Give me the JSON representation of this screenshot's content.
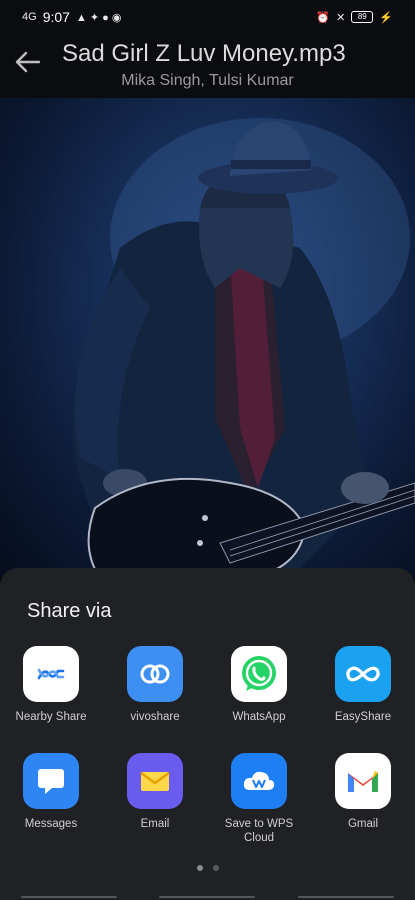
{
  "status_bar": {
    "signal": "4G",
    "time": "9:07",
    "battery": "89"
  },
  "header": {
    "title": "Sad Girl Z Luv Money.mp3",
    "artist": "Mika Singh, Tulsi Kumar"
  },
  "share": {
    "title": "Share via",
    "apps": [
      {
        "label": "Nearby Share",
        "icon": "nearby-share-icon",
        "bg": "#ffffff"
      },
      {
        "label": "vivoshare",
        "icon": "vivoshare-icon",
        "bg": "#3d8ff2"
      },
      {
        "label": "WhatsApp",
        "icon": "whatsapp-icon",
        "bg": "#ffffff"
      },
      {
        "label": "EasyShare",
        "icon": "easyshare-icon",
        "bg": "#1aa2f0"
      },
      {
        "label": "Messages",
        "icon": "messages-icon",
        "bg": "#2e86f5"
      },
      {
        "label": "Email",
        "icon": "email-icon",
        "bg": "#6b5cf0"
      },
      {
        "label": "Save to WPS Cloud",
        "icon": "wps-cloud-icon",
        "bg": "#1e7ff5"
      },
      {
        "label": "Gmail",
        "icon": "gmail-icon",
        "bg": "#ffffff"
      }
    ],
    "pages": 2,
    "current_page": 1
  }
}
